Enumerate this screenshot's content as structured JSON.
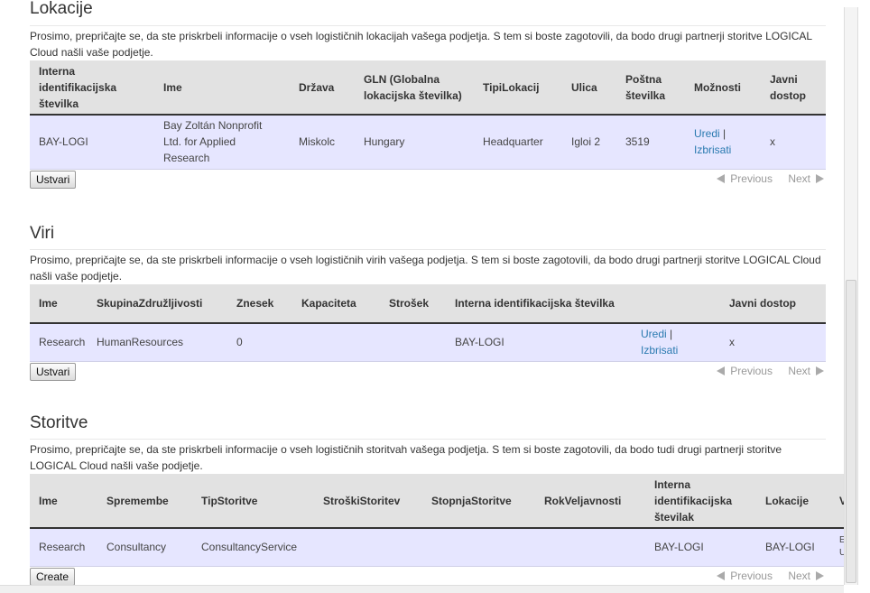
{
  "lokacije": {
    "title": "Lokacije",
    "intro": "Prosimo, prepričajte se, da ste priskrbeli informacije o vseh logističnih lokacijah vašega podjetja. S tem si boste zagotovili, da bodo drugi partnerji storitve LOGICAL Cloud našli vaše podjetje.",
    "headers": [
      "Interna identifikacijska številka",
      "Ime",
      "Država",
      "GLN (Globalna lokacijska številka)",
      "TipiLokacij",
      "Ulica",
      "Poštna številka",
      "Možnosti",
      "Javni dostop"
    ],
    "row": {
      "id": "BAY-LOGI",
      "name": "Bay Zoltán Nonprofit Ltd. for Applied Research",
      "city": "Miskolc",
      "gln": "Hungary",
      "type": "Headquarter",
      "street": "Igloi 2",
      "postal": "3519",
      "edit": "Uredi",
      "sep": " | ",
      "delete": "Izbrisati",
      "public": "x"
    },
    "create_label": "Ustvari",
    "prev_label": "Previous",
    "next_label": "Next"
  },
  "viri": {
    "title": "Viri",
    "intro": "Prosimo, prepričajte se, da ste priskrbeli informacije o vseh logističnih virih vašega podjetja. S tem si boste zagotovili, da bodo drugi partnerji storitve LOGICAL Cloud našli vaše podjetje.",
    "headers": [
      "Ime",
      "SkupinaZdružljivosti",
      "Znesek",
      "Kapaciteta",
      "Strošek",
      "Interna identifikacijska številka",
      "",
      "Javni dostop"
    ],
    "row": {
      "name": "Research",
      "group": "HumanResources",
      "amount": "0",
      "capacity": "",
      "cost": "",
      "id": "BAY-LOGI",
      "edit": "Uredi",
      "sep": " | ",
      "delete": "Izbrisati",
      "public": "x"
    },
    "create_label": "Ustvari",
    "prev_label": "Previous",
    "next_label": "Next"
  },
  "storitve": {
    "title": "Storitve",
    "intro": "Prosimo, prepričajte se, da ste priskrbeli informacije o vseh logističnih storitvah vašega podjetja. S tem si boste zagotovili, da bodo tudi drugi partnerji storitve LOGICAL Cloud našli vaše podjetje.",
    "headers": [
      "Ime",
      "Spremembe",
      "TipStoritve",
      "StroškiStoritev",
      "StopnjaStoritve",
      "RokVeljavnosti",
      "Interna identifikacijska številak",
      "Lokacije",
      "V"
    ],
    "row": {
      "name": "Research",
      "changes": "Consultancy",
      "type": "ConsultancyService",
      "cost": "",
      "level": "",
      "validity": "",
      "id": "BAY-LOGI",
      "location": "BAY-LOGI",
      "extra": "E\nU"
    },
    "create_label": "Create",
    "prev_label": "Previous",
    "next_label": "Next"
  }
}
